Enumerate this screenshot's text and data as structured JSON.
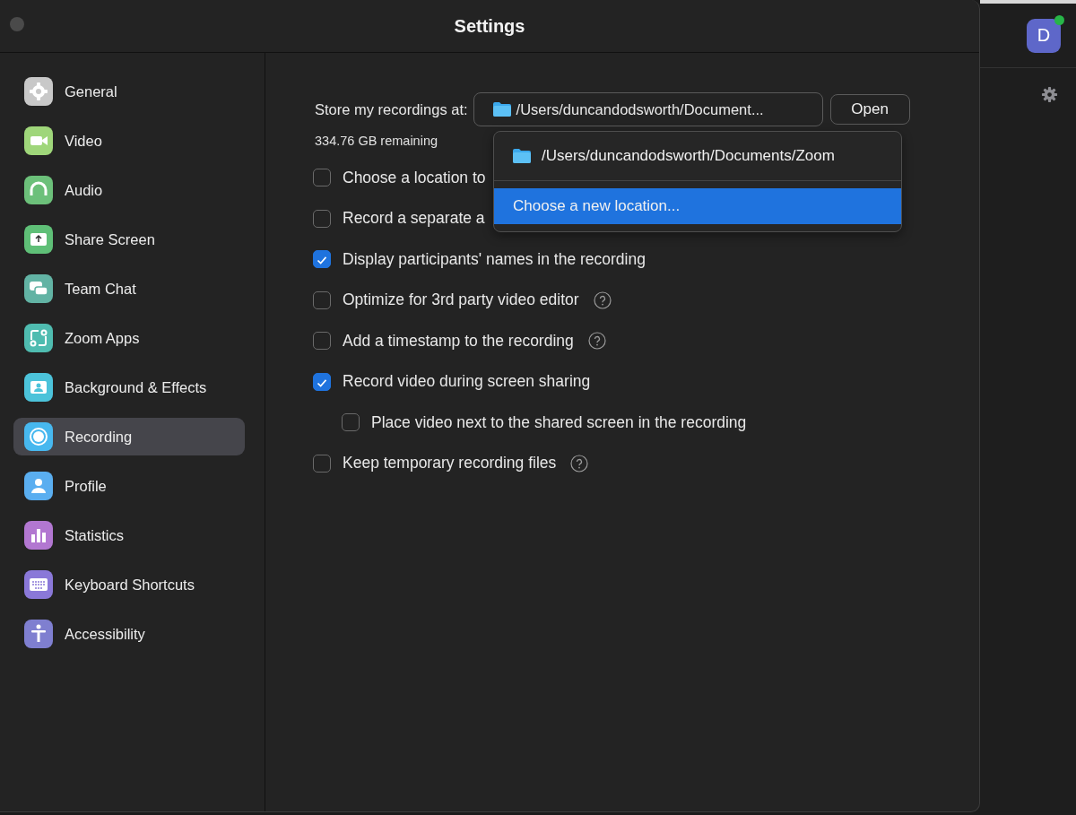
{
  "window": {
    "title": "Settings"
  },
  "sidebar": {
    "items": [
      {
        "label": "General",
        "kind": "gear",
        "color": "#c8c8c8",
        "selected": false
      },
      {
        "label": "Video",
        "kind": "video",
        "color": "#9fd67a",
        "selected": false
      },
      {
        "label": "Audio",
        "kind": "headphones",
        "color": "#6cc07a",
        "selected": false
      },
      {
        "label": "Share Screen",
        "kind": "share",
        "color": "#5fbf77",
        "selected": false
      },
      {
        "label": "Team Chat",
        "kind": "chat",
        "color": "#62b3a4",
        "selected": false
      },
      {
        "label": "Zoom Apps",
        "kind": "apps",
        "color": "#4fbcb0",
        "selected": false
      },
      {
        "label": "Background & Effects",
        "kind": "person",
        "color": "#4cc3da",
        "selected": false
      },
      {
        "label": "Recording",
        "kind": "record",
        "color": "#47b8ef",
        "selected": true
      },
      {
        "label": "Profile",
        "kind": "profile",
        "color": "#5aaef0",
        "selected": false
      },
      {
        "label": "Statistics",
        "kind": "stats",
        "color": "#b277d1",
        "selected": false
      },
      {
        "label": "Keyboard Shortcuts",
        "kind": "keyboard",
        "color": "#8a78d8",
        "selected": false
      },
      {
        "label": "Accessibility",
        "kind": "accessibility",
        "color": "#7f7fd0",
        "selected": false
      }
    ]
  },
  "recording": {
    "store_label": "Store my recordings at:",
    "location": "/Users/duncandodsworth/Document...",
    "open_button": "Open",
    "remaining": "334.76 GB remaining",
    "location_menu": {
      "items": [
        {
          "label": "/Users/duncandodsworth/Documents/Zoom",
          "kind": "folder",
          "selected": false
        },
        {
          "label": "Choose a new location...",
          "kind": "action",
          "selected": true
        }
      ]
    },
    "options": [
      {
        "label": "Choose a location to",
        "checked": false,
        "help": false
      },
      {
        "label": "Record a separate a",
        "checked": false,
        "help": false
      },
      {
        "label": "Display participants' names in the recording",
        "checked": true,
        "help": false
      },
      {
        "label": "Optimize for 3rd party video editor",
        "checked": false,
        "help": true
      },
      {
        "label": "Add a timestamp to the recording",
        "checked": false,
        "help": true
      },
      {
        "label": "Record video during screen sharing",
        "checked": true,
        "help": false,
        "children": [
          {
            "label": "Place video next to the shared screen in the recording",
            "checked": false,
            "help": false
          }
        ]
      },
      {
        "label": "Keep temporary recording files",
        "checked": false,
        "help": true
      }
    ]
  },
  "background_app": {
    "avatar": "D",
    "online": true
  }
}
